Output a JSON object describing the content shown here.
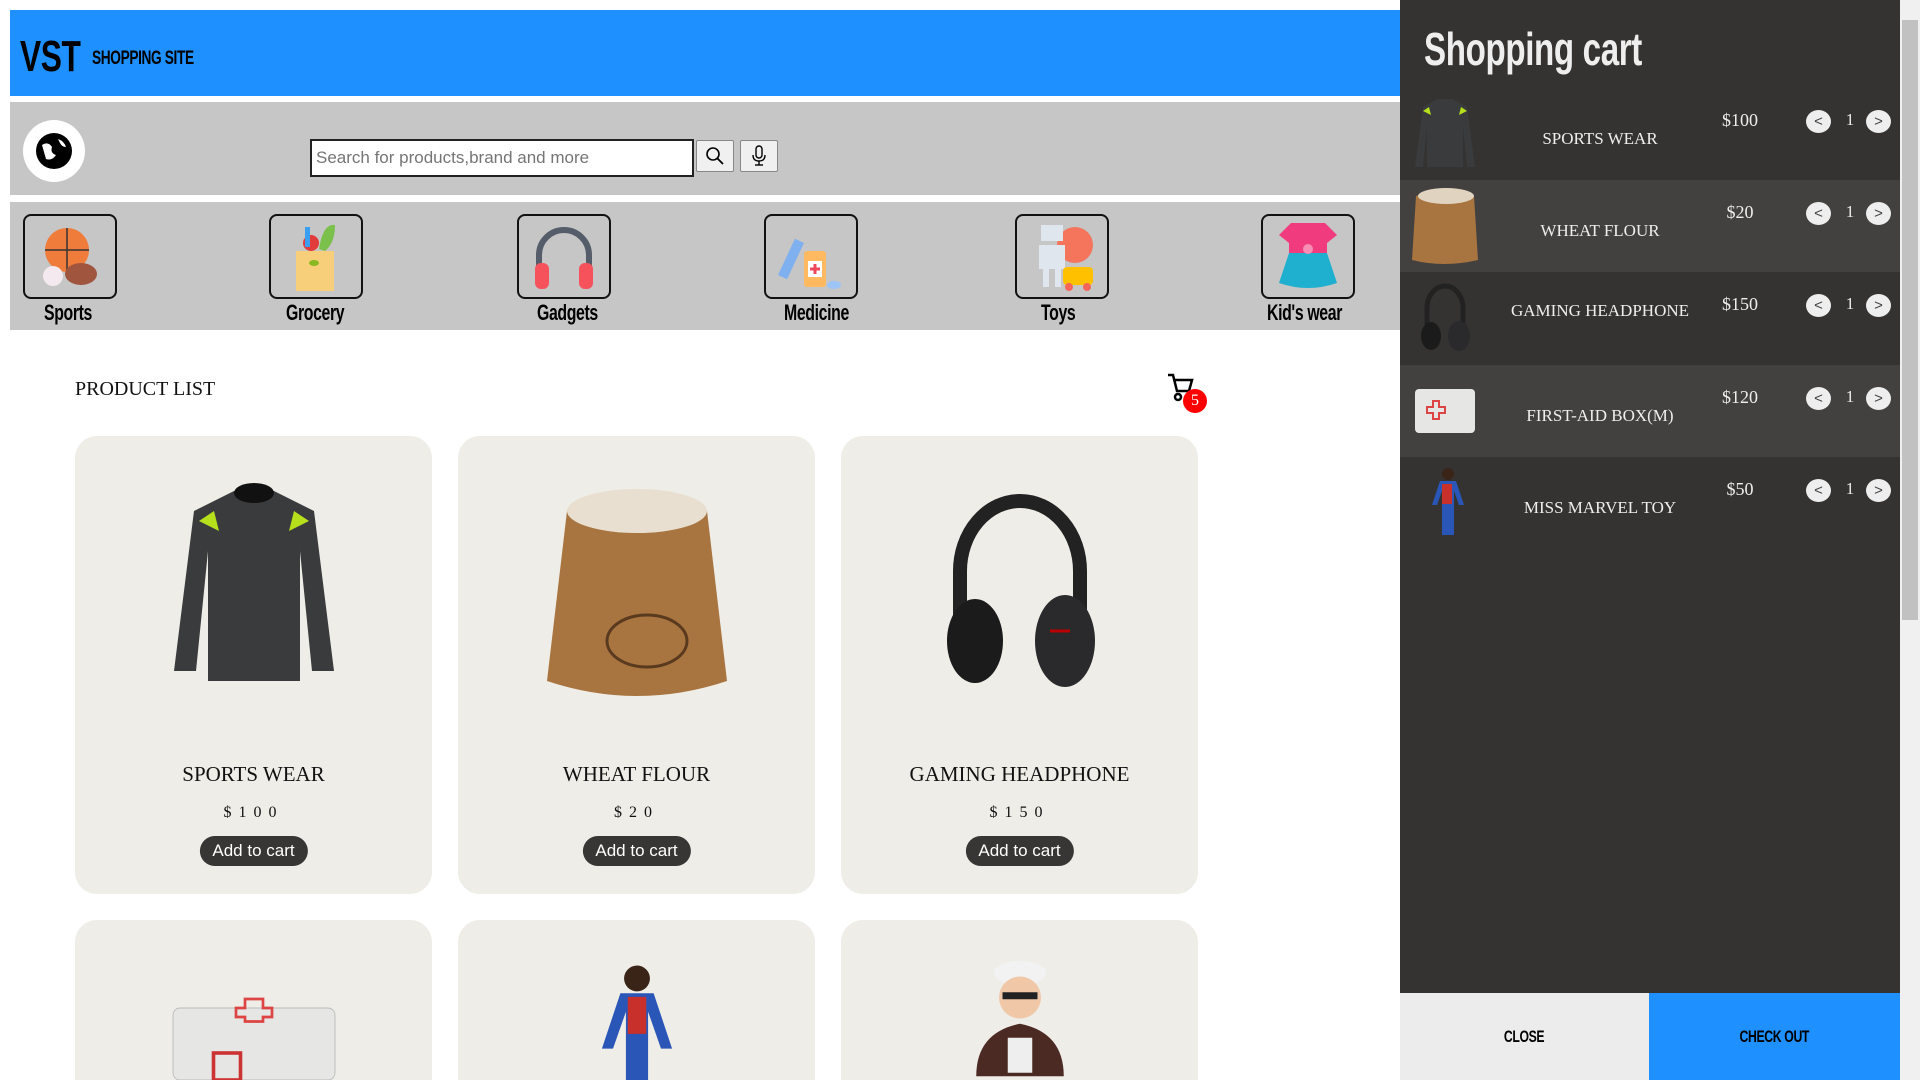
{
  "header": {
    "logo": "VST",
    "subtitle": "SHOPPING SITE"
  },
  "search": {
    "placeholder": "Search for products,brand and more",
    "search_icon": "search-icon",
    "mic_icon": "microphone-icon"
  },
  "categories": [
    {
      "label": "Sports"
    },
    {
      "label": "Grocery"
    },
    {
      "label": "Gadgets"
    },
    {
      "label": "Medicine"
    },
    {
      "label": "Toys"
    },
    {
      "label": "Kid's wear"
    }
  ],
  "main": {
    "title": "PRODUCT LIST",
    "cart_count": "5"
  },
  "products": [
    {
      "name": "SPORTS WEAR",
      "price": "$100",
      "button": "Add to cart"
    },
    {
      "name": "WHEAT FLOUR",
      "price": "$20",
      "button": "Add to cart"
    },
    {
      "name": "GAMING HEADPHONE",
      "price": "$150",
      "button": "Add to cart"
    }
  ],
  "cart": {
    "title": "Shopping cart",
    "items": [
      {
        "name": "SPORTS WEAR",
        "price": "$100",
        "qty": "1"
      },
      {
        "name": "WHEAT FLOUR",
        "price": "$20",
        "qty": "1"
      },
      {
        "name": "GAMING HEADPHONE",
        "price": "$150",
        "qty": "1"
      },
      {
        "name": "FIRST-AID BOX(M)",
        "price": "$120",
        "qty": "1"
      },
      {
        "name": "MISS MARVEL TOY",
        "price": "$50",
        "qty": "1"
      }
    ],
    "dec": "<",
    "inc": ">",
    "close": "CLOSE",
    "checkout": "CHECK OUT"
  },
  "colors": {
    "brand": "#1e90ff",
    "panel": "#353331",
    "card": "#eeede7",
    "badge": "#ff0000"
  }
}
